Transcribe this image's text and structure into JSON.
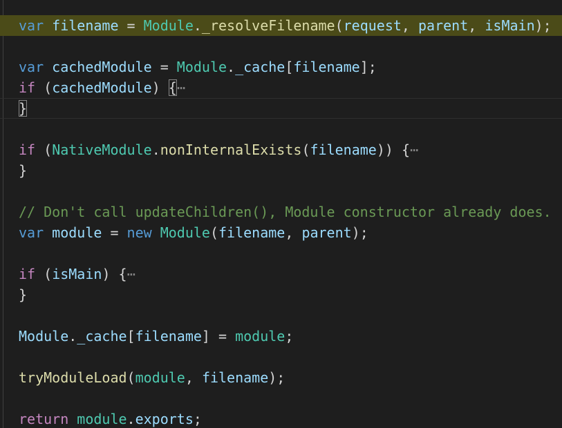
{
  "editor": {
    "fold_marker": "⋯",
    "lines": {
      "l1": {
        "kw": "var",
        "name": "filename",
        "op": " = ",
        "obj": "Module",
        "dot": ".",
        "fn": "_resolveFilename",
        "open": "(",
        "a1": "request",
        "sep1": ", ",
        "a2": "parent",
        "sep2": ", ",
        "a3": "isMain",
        "close": ");"
      },
      "l3": {
        "kw": "var",
        "name": "cachedModule",
        "op": " = ",
        "obj": "Module",
        "dot": ".",
        "prop": "_cache",
        "open": "[",
        "arg": "filename",
        "close": "];"
      },
      "l4": {
        "ctl": "if",
        "open": " (",
        "arg": "cachedModule",
        "close": ") ",
        "brace": "{"
      },
      "l5": {
        "brace": "}"
      },
      "l7": {
        "ctl": "if",
        "open": " (",
        "obj": "NativeModule",
        "dot": ".",
        "fn": "nonInternalExists",
        "popen": "(",
        "arg": "filename",
        "close": ")) ",
        "brace": "{"
      },
      "l8": {
        "brace": "}"
      },
      "l10": {
        "comment": "// Don't call updateChildren(), Module constructor already does."
      },
      "l11": {
        "kw": "var",
        "name": "module",
        "op": " = ",
        "kw2": "new",
        "sp": " ",
        "cls": "Module",
        "open": "(",
        "a1": "filename",
        "sep": ", ",
        "a2": "parent",
        "close": ");"
      },
      "l13": {
        "ctl": "if",
        "open": " (",
        "arg": "isMain",
        "close": ") ",
        "brace": "{"
      },
      "l14": {
        "brace": "}"
      },
      "l16": {
        "obj": "Module",
        "dot": ".",
        "prop": "_cache",
        "open": "[",
        "arg": "filename",
        "mid": "] = ",
        "val": "module",
        "close": ";"
      },
      "l18": {
        "fn": "tryModuleLoad",
        "open": "(",
        "a1": "module",
        "sep": ", ",
        "a2": "filename",
        "close": ");"
      },
      "l20": {
        "ctl": "return",
        "sp": " ",
        "obj": "module",
        "dot": ".",
        "prop": "exports",
        "close": ";"
      }
    }
  }
}
